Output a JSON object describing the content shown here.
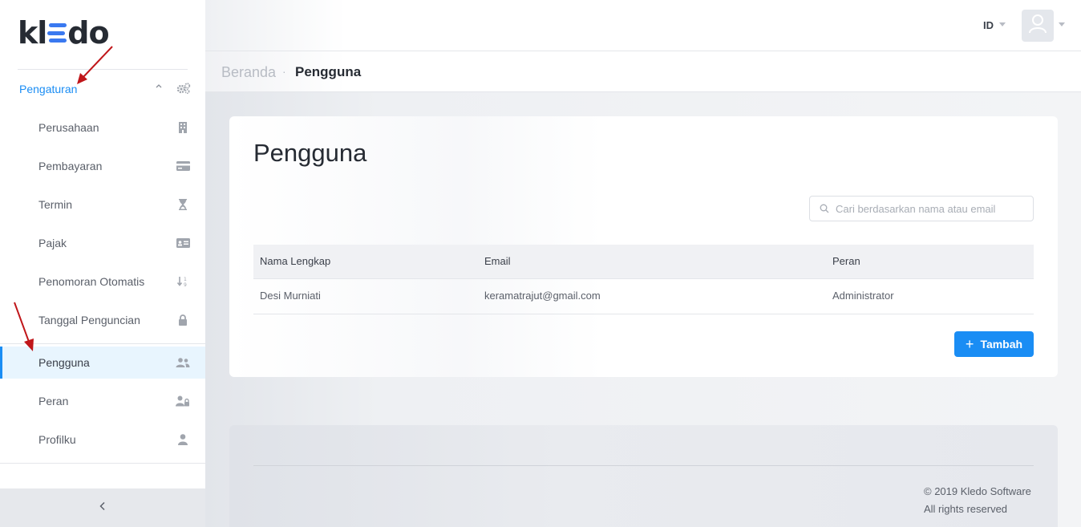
{
  "brand": {
    "logo_text_left": "kl",
    "logo_text_right": "do"
  },
  "sidebar": {
    "group_label": "Pengaturan",
    "items": [
      {
        "label": "Perusahaan",
        "icon": "building-icon"
      },
      {
        "label": "Pembayaran",
        "icon": "credit-card-icon"
      },
      {
        "label": "Termin",
        "icon": "hourglass-icon"
      },
      {
        "label": "Pajak",
        "icon": "id-card-icon"
      },
      {
        "label": "Penomoran Otomatis",
        "icon": "sort-numeric-icon"
      },
      {
        "label": "Tanggal Penguncian",
        "icon": "lock-icon"
      },
      {
        "label": "Pengguna",
        "icon": "users-icon",
        "active": true
      },
      {
        "label": "Peran",
        "icon": "user-lock-icon"
      },
      {
        "label": "Profilku",
        "icon": "user-icon"
      }
    ],
    "collapse_glyph": "<"
  },
  "header": {
    "language": "ID"
  },
  "breadcrumb": {
    "home": "Beranda",
    "separator": "·",
    "current": "Pengguna"
  },
  "page": {
    "title": "Pengguna",
    "search_placeholder": "Cari berdasarkan nama atau email",
    "table": {
      "columns": [
        "Nama Lengkap",
        "Email",
        "Peran"
      ],
      "rows": [
        [
          "Desi Murniati",
          "keramatrajut@gmail.com",
          "Administrator"
        ]
      ]
    },
    "add_button": {
      "plus": "+",
      "label": "Tambah"
    }
  },
  "footer": {
    "copyright_prefix": "© 2019 ",
    "company": "Kledo Software",
    "rights": "All rights reserved"
  },
  "colors": {
    "accent": "#1a8df4",
    "logo_blue": "#3a79f0",
    "annotation_arrow": "#c0161a"
  }
}
